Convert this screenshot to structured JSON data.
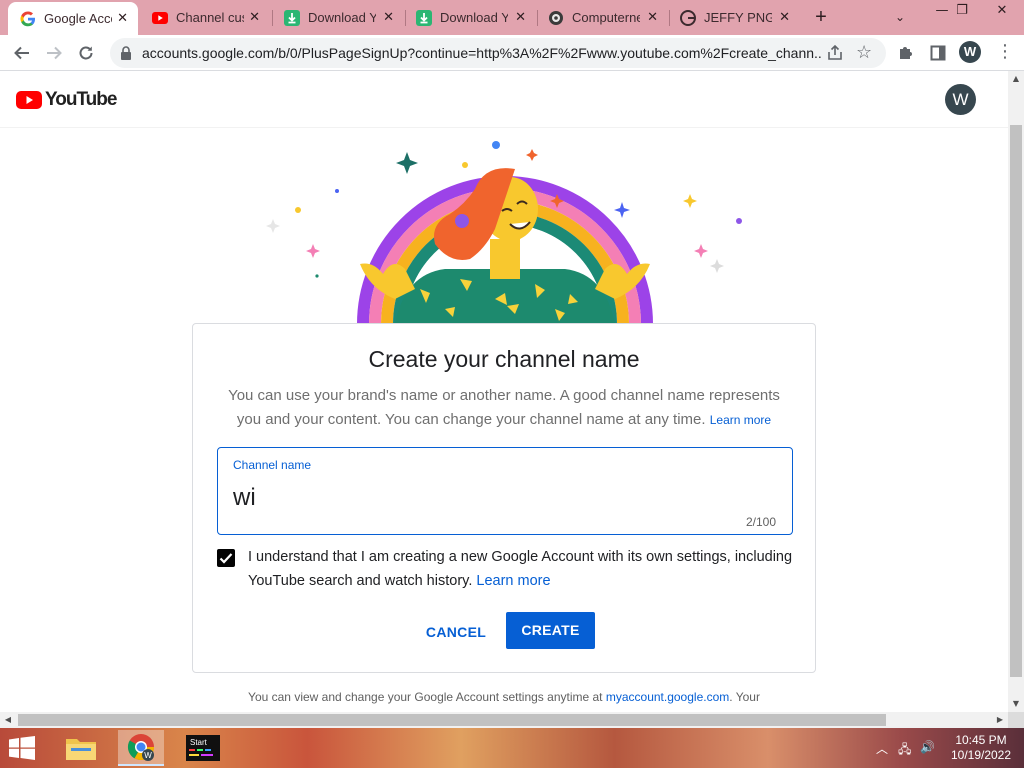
{
  "browser": {
    "tabs": [
      {
        "title": "Google Accou",
        "favicon": "google-g-icon",
        "active": true
      },
      {
        "title": "Channel cust",
        "favicon": "youtube-icon",
        "active": false
      },
      {
        "title": "Download Yo",
        "favicon": "download-icon",
        "active": false
      },
      {
        "title": "Download Yo",
        "favicon": "download-icon",
        "active": false
      },
      {
        "title": "Computerne",
        "favicon": "site-icon",
        "active": false
      },
      {
        "title": "JEFFY PNG -",
        "favicon": "google-g-icon",
        "active": false
      }
    ],
    "url": "accounts.google.com/b/0/PlusPageSignUp?continue=http%3A%2F%2Fwww.youtube.com%2Fcreate_chann...",
    "profile_initial": "W"
  },
  "page": {
    "logo_text": "YouTube",
    "avatar_initial": "W",
    "title": "Create your channel name",
    "description": "You can use your brand's name or another name. A good channel name represents you and your content. You can change your channel name at any time.",
    "description_link": "Learn more",
    "field": {
      "label": "Channel name",
      "value": "wi",
      "counter": "2/100"
    },
    "consent": {
      "checked": true,
      "text": "I understand that I am creating a new Google Account with its own settings, including YouTube search and watch history.",
      "link": "Learn more"
    },
    "buttons": {
      "cancel": "CANCEL",
      "create": "CREATE"
    },
    "footer": {
      "text": "You can view and change your Google Account settings anytime at",
      "link": "myaccount.google.com",
      "tail": ". Your"
    }
  },
  "taskbar": {
    "clock_time": "10:45 PM",
    "clock_date": "10/19/2022",
    "app_label": "Start"
  },
  "colors": {
    "accent": "#065fd4",
    "tabstrip": "#e1a3ae",
    "youtube_red": "#ff0000"
  }
}
